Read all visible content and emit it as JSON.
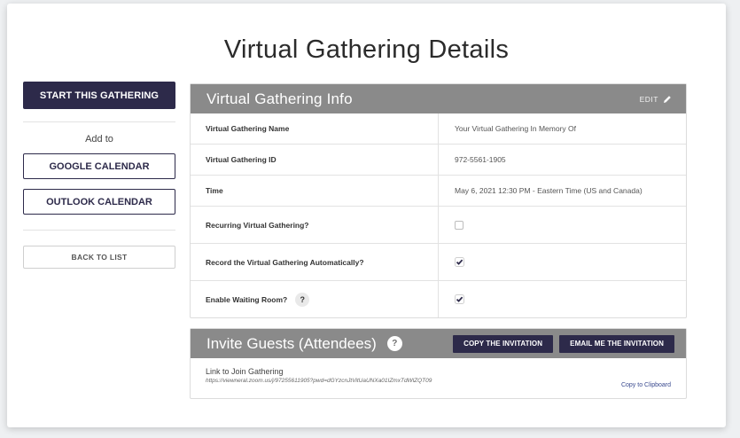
{
  "page": {
    "title": "Virtual Gathering Details"
  },
  "sidebar": {
    "start_label": "START THIS GATHERING",
    "add_to_label": "Add to",
    "google_label": "GOOGLE CALENDAR",
    "outlook_label": "OUTLOOK CALENDAR",
    "back_label": "BACK TO LIST"
  },
  "info_panel": {
    "title": "Virtual Gathering Info",
    "edit_label": "EDIT",
    "rows": [
      {
        "label": "Virtual Gathering Name",
        "value": "Your Virtual Gathering In Memory Of"
      },
      {
        "label": "Virtual Gathering ID",
        "value": "972-5561-1905"
      },
      {
        "label": "Time",
        "value": "May 6, 2021 12:30 PM - Eastern Time (US and Canada)"
      },
      {
        "label": "Recurring Virtual Gathering?",
        "checked": false
      },
      {
        "label": "Record the Virtual Gathering Automatically?",
        "checked": true
      },
      {
        "label": "Enable Waiting Room?",
        "checked": true,
        "help": "?"
      }
    ]
  },
  "invite_panel": {
    "title": "Invite Guests (Attendees)",
    "help": "?",
    "copy_invitation_label": "COPY THE INVITATION",
    "email_invitation_label": "EMAIL ME THE INVITATION",
    "link_label": "Link to Join Gathering",
    "link_url": "https://viewneral.zoom.us/j/97255611905?pwd=dGYzcnJtVitUaUNXa01IZmxTdWlZQT09",
    "copy_clipboard_label": "Copy to Clipboard"
  },
  "colors": {
    "primary": "#2d2a4a",
    "header_gray": "#8a8a8a",
    "link": "#3a4a8f"
  }
}
